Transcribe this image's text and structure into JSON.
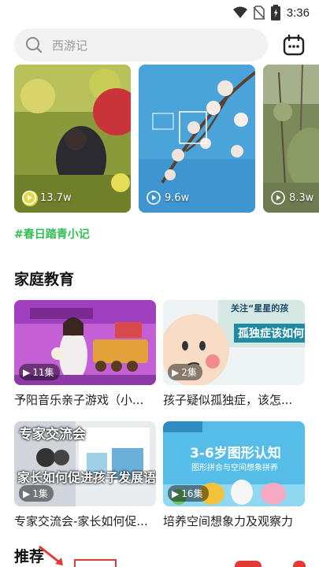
{
  "status_bar": {
    "time": "3:36"
  },
  "search": {
    "placeholder": "西游记"
  },
  "videos": [
    {
      "views": "13.7w"
    },
    {
      "views": "9.6w"
    },
    {
      "views": "8.3w"
    }
  ],
  "hashtag": "#春日踏青小记",
  "family_section": {
    "title": "家庭教育",
    "items": [
      {
        "title": "予阳音乐亲子游戏（小...",
        "episodes": "11集"
      },
      {
        "title": "孩子疑似孤独症，该怎...",
        "episodes": "2集"
      },
      {
        "title": "专家交流会-家长如何促...",
        "episodes": "1集"
      },
      {
        "title": "培养空间想象力及观察力",
        "episodes": "16集"
      }
    ],
    "thumb_texts": {
      "card2_heading": "关注“星星的孩",
      "card2_sub": "孤独症该如何",
      "card3_top": "专家交流会",
      "card3_main": "家长如何促进孩子发展语言",
      "card4_title": "3-6岁图形认知",
      "card4_sub": "图形拼合与空间想象拼养"
    }
  },
  "next_section": {
    "title": "推荐"
  },
  "colors": {
    "accent_green": "#2fbf52",
    "search_bg": "#f2f2f2"
  }
}
